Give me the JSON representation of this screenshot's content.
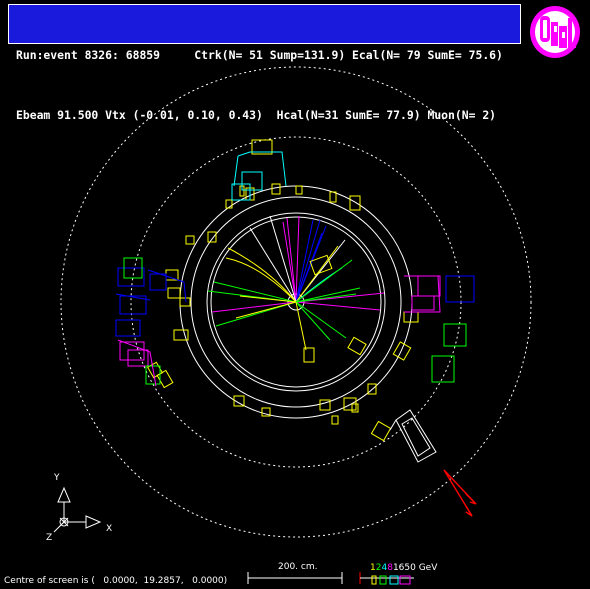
{
  "header": {
    "line1": "Run:event 8326: 68859     Ctrk(N= 51 Sump=131.9) Ecal(N= 79 SumE= 75.6)",
    "line2": "Ebeam 91.500 Vtx (-0.01, 0.10, 0.43)  Hcal(N=31 SumE= 77.9) Muon(N= 2)"
  },
  "logo": {
    "text": "OPAL",
    "colors": {
      "ring": "#ff00ff",
      "fill": "#ffffff",
      "letters": "#ff00ff"
    }
  },
  "axes": {
    "y_label": "Y",
    "x_label": "X",
    "z_label": "Z"
  },
  "footer": {
    "centre_text": "Centre of screen is (   0.0000,  19.2857,   0.0000)",
    "scale_label": "200. cm.",
    "energy_scale": {
      "values": [
        "1",
        "2",
        "4",
        "8",
        "16",
        "50 GeV"
      ],
      "colors": [
        "#ffff00",
        "#00ff00",
        "#00ffff",
        "#ff00ff",
        "#ffffff",
        "#ffffff"
      ]
    }
  },
  "colors": {
    "background": "#000000",
    "header_bg": "#1a1adc",
    "detector": "#ffffff",
    "ecal": "#ffff00",
    "hcal": "#00ff00",
    "muon_arrow": "#ff0000",
    "track_pink": "#ff00ff",
    "track_blue": "#0000ff",
    "track_cyan": "#00ffff"
  }
}
